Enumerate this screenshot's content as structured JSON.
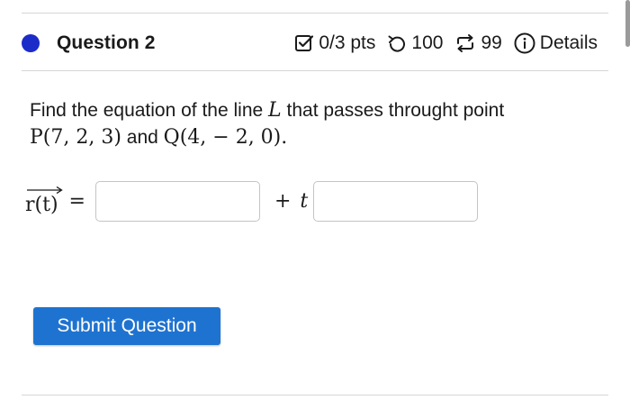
{
  "question": {
    "title": "Question 2",
    "points": "0/3 pts",
    "retries": "100",
    "attempts": "99",
    "details_label": "Details",
    "prompt_lead": "Find the equation of the line",
    "line_name": "L",
    "prompt_mid": "that passes throught point",
    "point_p": "P(7, 2, 3)",
    "connector": "and",
    "point_q": "Q(4, − 2, 0)",
    "terminal": "."
  },
  "answer": {
    "vector_label": "r(t)",
    "equals": "=",
    "plus": "+",
    "param": "t",
    "point_value": "",
    "direction_value": ""
  },
  "submit_label": "Submit Question",
  "colors": {
    "status_dot": "#1b2cc8",
    "submit_bg": "#1f73d0"
  }
}
